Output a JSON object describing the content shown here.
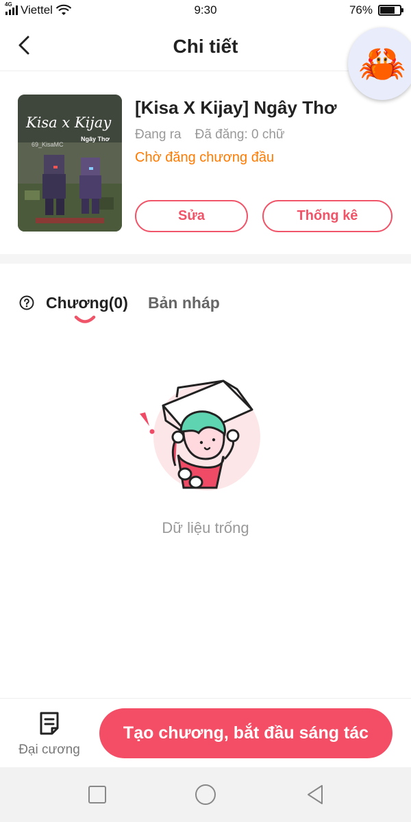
{
  "status_bar": {
    "network": "4G",
    "carrier": "Viettel",
    "time": "9:30",
    "battery": "76%",
    "battery_level": 0.76
  },
  "header": {
    "title": "Chi tiết",
    "back_icon": "chevron-left-icon",
    "avatar_icon": "crab-icon",
    "avatar_emoji": "🦀"
  },
  "book": {
    "title": "[Kisa X Kijay] Ngây Thơ",
    "status": "Đang ra",
    "published": "Đã đăng: 0 chữ",
    "waiting": "Chờ đăng chương đầu",
    "cover": {
      "title": "Kisa x Kijay",
      "subtitle": "Ngây Thơ",
      "tag": "69_KisaMC"
    },
    "edit_label": "Sửa",
    "stats_label": "Thống kê"
  },
  "tabs": [
    {
      "label": "Chương(0)",
      "active": true
    },
    {
      "label": "Bản nháp",
      "active": false
    }
  ],
  "empty_state": {
    "text": "Dữ liệu trống"
  },
  "bottom_bar": {
    "outline_label": "Đại cương",
    "outline_icon": "document-icon",
    "create_label": "Tạo chương, bắt đầu sáng tác"
  },
  "colors": {
    "accent": "#f44e66",
    "warning": "#ff7a00",
    "muted": "#999999"
  }
}
